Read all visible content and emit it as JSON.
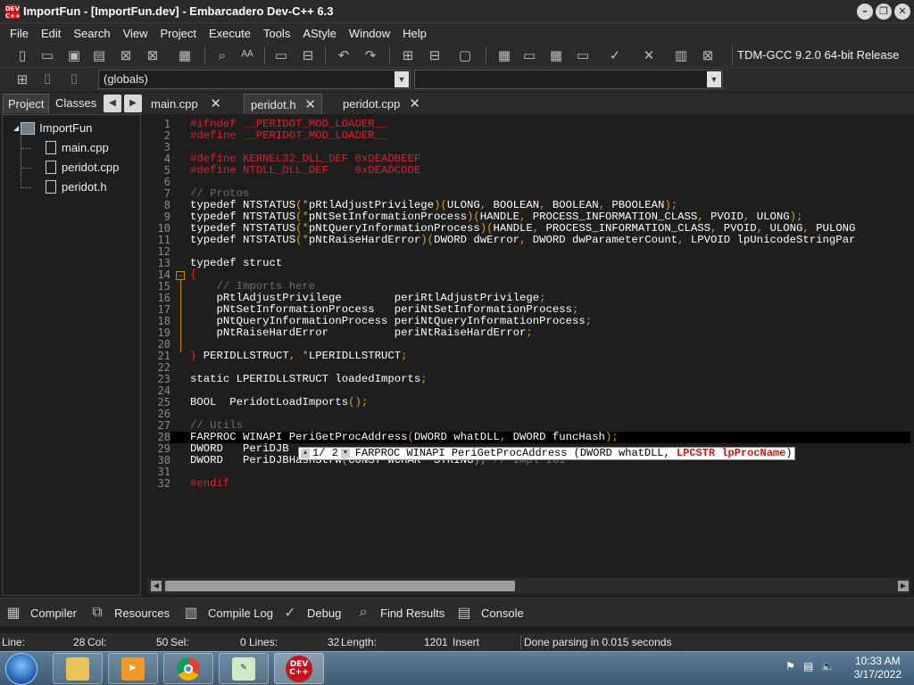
{
  "window": {
    "title": "ImportFun - [ImportFun.dev] - Embarcadero Dev-C++ 6.3",
    "app_icon_text": "DEV C++",
    "controls": [
      "minimize",
      "restore",
      "close"
    ]
  },
  "menu": [
    "File",
    "Edit",
    "Search",
    "View",
    "Project",
    "Execute",
    "Tools",
    "AStyle",
    "Window",
    "Help"
  ],
  "toolbar": {
    "compiler": "TDM-GCC 9.2.0 64-bit Release",
    "scope_combo": "(globals)",
    "function_combo": ""
  },
  "left_panel": {
    "tabs": [
      "Project",
      "Classes"
    ],
    "project": "ImportFun",
    "files": [
      "main.cpp",
      "peridot.cpp",
      "peridot.h"
    ]
  },
  "editor_tabs": [
    "main.cpp",
    "peridot.h",
    "peridot.cpp"
  ],
  "active_tab": "peridot.h",
  "code_lines": [
    {
      "n": "1",
      "parts": [
        [
          "pp",
          "#ifndef __PERIDOT_MOD_LOADER__"
        ]
      ]
    },
    {
      "n": "2",
      "parts": [
        [
          "pp",
          "#define __PERIDOT_MOD_LOADER__"
        ]
      ]
    },
    {
      "n": "3",
      "parts": []
    },
    {
      "n": "4",
      "parts": [
        [
          "pp",
          "#define KERNEL32_DLL_DEF 0xDEADBEEF"
        ]
      ]
    },
    {
      "n": "5",
      "parts": [
        [
          "pp",
          "#define NTDLL_DLL_DEF    0xDEADCODE"
        ]
      ]
    },
    {
      "n": "6",
      "parts": []
    },
    {
      "n": "7",
      "parts": [
        [
          "cm",
          "// Protos"
        ]
      ]
    },
    {
      "n": "8",
      "parts": [
        [
          "kw",
          "typedef NTSTATUS"
        ],
        [
          "op",
          "(*"
        ],
        [
          "kw",
          "pRtlAdjustPrivilege"
        ],
        [
          "op",
          ")("
        ],
        [
          "kw",
          "ULONG"
        ],
        [
          "op",
          ", "
        ],
        [
          "kw",
          "BOOLEAN"
        ],
        [
          "op",
          ", "
        ],
        [
          "kw",
          "BOOLEAN"
        ],
        [
          "op",
          ", "
        ],
        [
          "kw",
          "PBOOLEAN"
        ],
        [
          "op",
          ");"
        ]
      ]
    },
    {
      "n": "9",
      "parts": [
        [
          "kw",
          "typedef NTSTATUS"
        ],
        [
          "op",
          "(*"
        ],
        [
          "kw",
          "pNtSetInformationProcess"
        ],
        [
          "op",
          ")("
        ],
        [
          "kw",
          "HANDLE"
        ],
        [
          "op",
          ", "
        ],
        [
          "kw",
          "PROCESS_INFORMATION_CLASS"
        ],
        [
          "op",
          ", "
        ],
        [
          "kw",
          "PVOID"
        ],
        [
          "op",
          ", "
        ],
        [
          "kw",
          "ULONG"
        ],
        [
          "op",
          ");"
        ]
      ]
    },
    {
      "n": "10",
      "parts": [
        [
          "kw",
          "typedef NTSTATUS"
        ],
        [
          "op",
          "(*"
        ],
        [
          "kw",
          "pNtQueryInformationProcess"
        ],
        [
          "op",
          ")("
        ],
        [
          "kw",
          "HANDLE"
        ],
        [
          "op",
          ", "
        ],
        [
          "kw",
          "PROCESS_INFORMATION_CLASS"
        ],
        [
          "op",
          ", "
        ],
        [
          "kw",
          "PVOID"
        ],
        [
          "op",
          ", "
        ],
        [
          "kw",
          "ULONG"
        ],
        [
          "op",
          ", "
        ],
        [
          "kw",
          "PULONG"
        ]
      ]
    },
    {
      "n": "11",
      "parts": [
        [
          "kw",
          "typedef NTSTATUS"
        ],
        [
          "op",
          "(*"
        ],
        [
          "kw",
          "pNtRaiseHardError"
        ],
        [
          "op",
          ")("
        ],
        [
          "kw",
          "DWORD dwError"
        ],
        [
          "op",
          ", "
        ],
        [
          "kw",
          "DWORD dwParameterCount"
        ],
        [
          "op",
          ", "
        ],
        [
          "kw",
          "LPVOID lpUnicodeStringPar"
        ]
      ]
    },
    {
      "n": "12",
      "parts": []
    },
    {
      "n": "13",
      "parts": [
        [
          "kw",
          "typedef struct"
        ]
      ]
    },
    {
      "n": "14",
      "parts": [
        [
          "pp",
          "{"
        ]
      ]
    },
    {
      "n": "15",
      "parts": [
        [
          "cm",
          "    // Imports here"
        ]
      ]
    },
    {
      "n": "16",
      "parts": [
        [
          "kw",
          "    pRtlAdjustPrivilege        periRtlAdjustPrivilege"
        ],
        [
          "op",
          ";"
        ]
      ]
    },
    {
      "n": "17",
      "parts": [
        [
          "kw",
          "    pNtSetInformationProcess   periNtSetInformationProcess"
        ],
        [
          "op",
          ";"
        ]
      ]
    },
    {
      "n": "18",
      "parts": [
        [
          "kw",
          "    pNtQueryInformationProcess periNtQueryInformationProcess"
        ],
        [
          "op",
          ";"
        ]
      ]
    },
    {
      "n": "19",
      "parts": [
        [
          "kw",
          "    pNtRaiseHardError          periNtRaiseHardError"
        ],
        [
          "op",
          ";"
        ]
      ]
    },
    {
      "n": "20",
      "parts": []
    },
    {
      "n": "21",
      "parts": [
        [
          "pp",
          "}"
        ],
        [
          "kw",
          " PERIDLLSTRUCT"
        ],
        [
          "op",
          ", *"
        ],
        [
          "kw",
          "LPERIDLLSTRUCT"
        ],
        [
          "op",
          ";"
        ]
      ]
    },
    {
      "n": "22",
      "parts": []
    },
    {
      "n": "23",
      "parts": [
        [
          "kw",
          "static LPERIDLLSTRUCT loadedImports"
        ],
        [
          "op",
          ";"
        ]
      ]
    },
    {
      "n": "24",
      "parts": []
    },
    {
      "n": "25",
      "parts": [
        [
          "kw",
          "BOOL  PeridotLoadImports"
        ],
        [
          "op",
          "();"
        ]
      ]
    },
    {
      "n": "26",
      "parts": []
    },
    {
      "n": "27",
      "parts": [
        [
          "cm",
          "// Utils"
        ]
      ]
    },
    {
      "n": "28",
      "parts": [
        [
          "kw",
          "FARPROC WINAPI PeriGetProcAddress"
        ],
        [
          "op",
          "("
        ],
        [
          "kw",
          "DWORD whatDLL"
        ],
        [
          "op",
          ", "
        ],
        [
          "kw",
          "DWORD funcHash"
        ],
        [
          "op",
          ");"
        ]
      ]
    },
    {
      "n": "29",
      "parts": [
        [
          "kw",
          "DWORD   PeriDJB"
        ]
      ]
    },
    {
      "n": "30",
      "parts": [
        [
          "kw",
          "DWORD   PeriDJBHashStrW"
        ],
        [
          "op",
          "("
        ],
        [
          "kw",
          "CONST WCHAR *STRING"
        ],
        [
          "op",
          "); "
        ],
        [
          "cm",
          "// Impl iGi"
        ]
      ]
    },
    {
      "n": "31",
      "parts": []
    },
    {
      "n": "32",
      "parts": [
        [
          "pp",
          "#endif"
        ]
      ]
    }
  ],
  "call_tip": {
    "counter": "1/ 2",
    "prefix": "FARPROC WINAPI PeriGetProcAddress (DWORD whatDLL, ",
    "highlight": "LPCSTR lpProcName",
    "suffix": ")"
  },
  "bottom_tabs": [
    "Compiler",
    "Resources",
    "Compile Log",
    "Debug",
    "Find Results",
    "Console"
  ],
  "status": {
    "line_label": "Line:",
    "line": "28",
    "col_label": "Col:",
    "col": "50",
    "sel_label": "Sel:",
    "sel": "0",
    "lines_label": "Lines:",
    "lines": "32",
    "length_label": "Length:",
    "length": "1201",
    "mode": "Insert",
    "message": "Done parsing in 0.015 seconds"
  },
  "taskbar": {
    "apps": [
      "explorer",
      "media-player",
      "chrome",
      "notepad",
      "dev-cpp"
    ],
    "time": "10:33 AM",
    "date": "3/17/2022"
  },
  "colors": {
    "preprocessor": "#e0202a",
    "comment": "#6f6f6f",
    "punctuation": "#d4a020",
    "code": "#ffffff",
    "background": "#1e1e1e"
  }
}
